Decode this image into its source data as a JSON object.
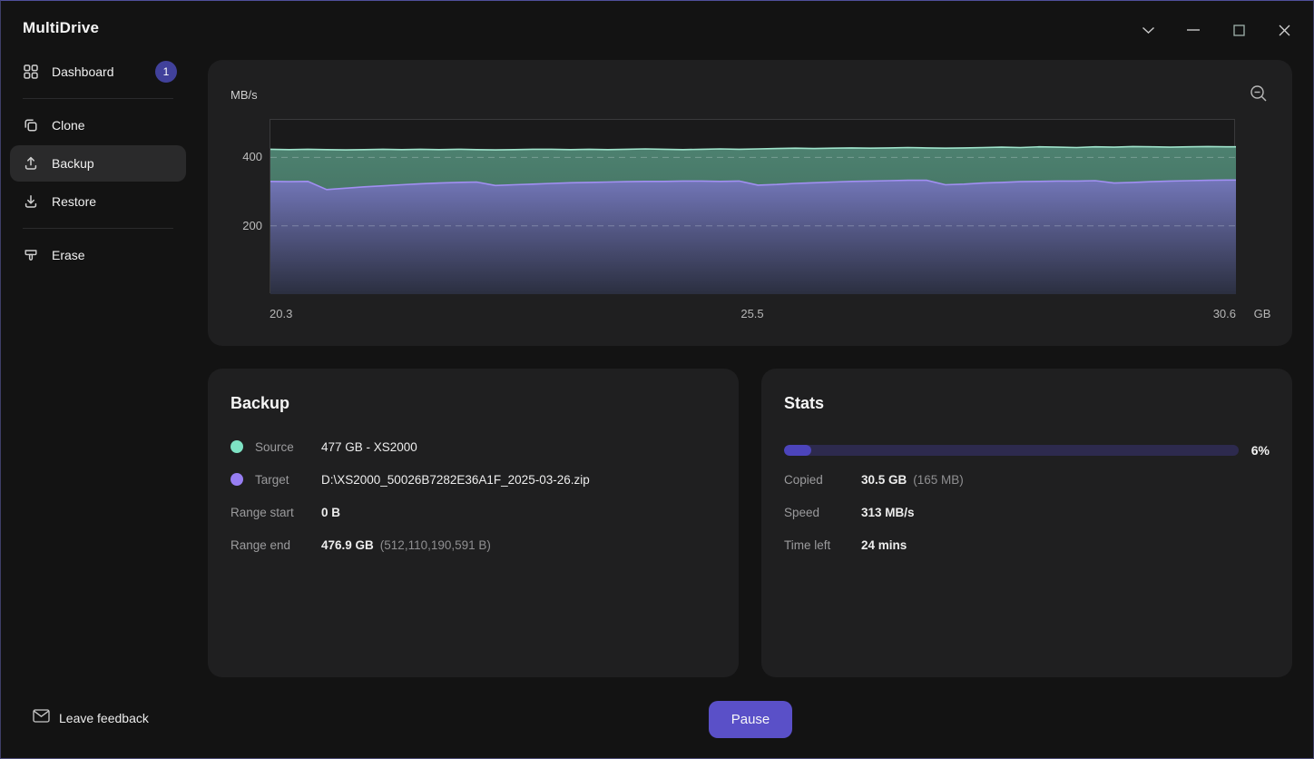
{
  "window": {
    "title": "MultiDrive"
  },
  "sidebar": {
    "items": [
      {
        "label": "Dashboard",
        "icon": "grid",
        "badge": "1",
        "active": false,
        "divider_after": true
      },
      {
        "label": "Clone",
        "icon": "copy",
        "badge": null,
        "active": false,
        "divider_after": false
      },
      {
        "label": "Backup",
        "icon": "upload",
        "badge": null,
        "active": true,
        "divider_after": false
      },
      {
        "label": "Restore",
        "icon": "download",
        "badge": null,
        "active": false,
        "divider_after": true
      },
      {
        "label": "Erase",
        "icon": "eraser",
        "badge": null,
        "active": false,
        "divider_after": false
      }
    ],
    "feedback_label": "Leave feedback"
  },
  "chart": {
    "ylabel": "MB/s",
    "yticks": [
      "400",
      "200"
    ],
    "xticks": [
      "20.3",
      "25.5",
      "30.6"
    ],
    "unit": "GB"
  },
  "chart_data": {
    "type": "area",
    "ylabel": "MB/s",
    "x_unit": "GB",
    "xlim": [
      20.3,
      30.6
    ],
    "ylim": [
      0,
      510
    ],
    "xticks": [
      20.3,
      25.5,
      30.6
    ],
    "yticks": [
      200,
      400
    ],
    "grid": "dashed-horizontal",
    "x_gb": [
      20.3,
      20.5,
      20.7,
      20.9,
      21.1,
      21.3,
      21.5,
      21.7,
      21.9,
      22.1,
      22.3,
      22.5,
      22.7,
      22.9,
      23.1,
      23.3,
      23.5,
      23.7,
      23.9,
      24.1,
      24.3,
      24.5,
      24.7,
      24.9,
      25.1,
      25.3,
      25.5,
      25.7,
      25.9,
      26.1,
      26.3,
      26.5,
      26.7,
      26.9,
      27.1,
      27.3,
      27.5,
      27.7,
      27.9,
      28.1,
      28.3,
      28.5,
      28.7,
      28.9,
      29.1,
      29.3,
      29.5,
      29.7,
      29.9,
      30.1,
      30.3,
      30.5,
      30.6
    ],
    "series": [
      {
        "name": "source-read-speed",
        "line_color": "#9fe3cb",
        "fill_top": "#4d8170",
        "fill_bottom": "#3c6354",
        "values": [
          424,
          423,
          424,
          423,
          422,
          423,
          424,
          423,
          424,
          423,
          424,
          423,
          422,
          423,
          424,
          424,
          423,
          424,
          423,
          424,
          425,
          424,
          423,
          424,
          425,
          424,
          425,
          426,
          427,
          426,
          427,
          428,
          427,
          428,
          429,
          428,
          427,
          428,
          429,
          430,
          429,
          431,
          430,
          429,
          431,
          430,
          432,
          431,
          430,
          431,
          432,
          431,
          431
        ]
      },
      {
        "name": "target-write-speed",
        "line_color": "#a18ff2",
        "fill_top": "#7276b8",
        "fill_bottom": "#2b2f40",
        "values": [
          330,
          329,
          330,
          306,
          310,
          314,
          317,
          320,
          323,
          325,
          327,
          328,
          318,
          320,
          322,
          324,
          326,
          327,
          328,
          329,
          330,
          330,
          331,
          331,
          330,
          331,
          319,
          321,
          324,
          326,
          328,
          330,
          331,
          332,
          333,
          333,
          320,
          322,
          325,
          327,
          329,
          330,
          331,
          331,
          332,
          325,
          327,
          329,
          331,
          332,
          333,
          334,
          334
        ]
      }
    ]
  },
  "backup_card": {
    "title": "Backup",
    "rows": [
      {
        "label": "Source",
        "dot_color": "#7ee2c4",
        "value": "477 GB - XS2000",
        "secondary": ""
      },
      {
        "label": "Target",
        "dot_color": "#977ef2",
        "value": "D:\\XS2000_50026B7282E36A1F_2025-03-26.zip",
        "secondary": ""
      },
      {
        "label": "Range start",
        "dot_color": null,
        "value": "0 B",
        "secondary": ""
      },
      {
        "label": "Range end",
        "dot_color": null,
        "value": "476.9 GB",
        "secondary": "(512,110,190,591 B)"
      }
    ]
  },
  "stats_card": {
    "title": "Stats",
    "progress": {
      "percent": 6,
      "label": "6%"
    },
    "rows": [
      {
        "label": "Copied",
        "value": "30.5 GB",
        "secondary": "(165 MB)"
      },
      {
        "label": "Speed",
        "value": "313 MB/s",
        "secondary": ""
      },
      {
        "label": "Time left",
        "value": "24 mins",
        "secondary": ""
      }
    ]
  },
  "footer": {
    "pause_label": "Pause"
  }
}
